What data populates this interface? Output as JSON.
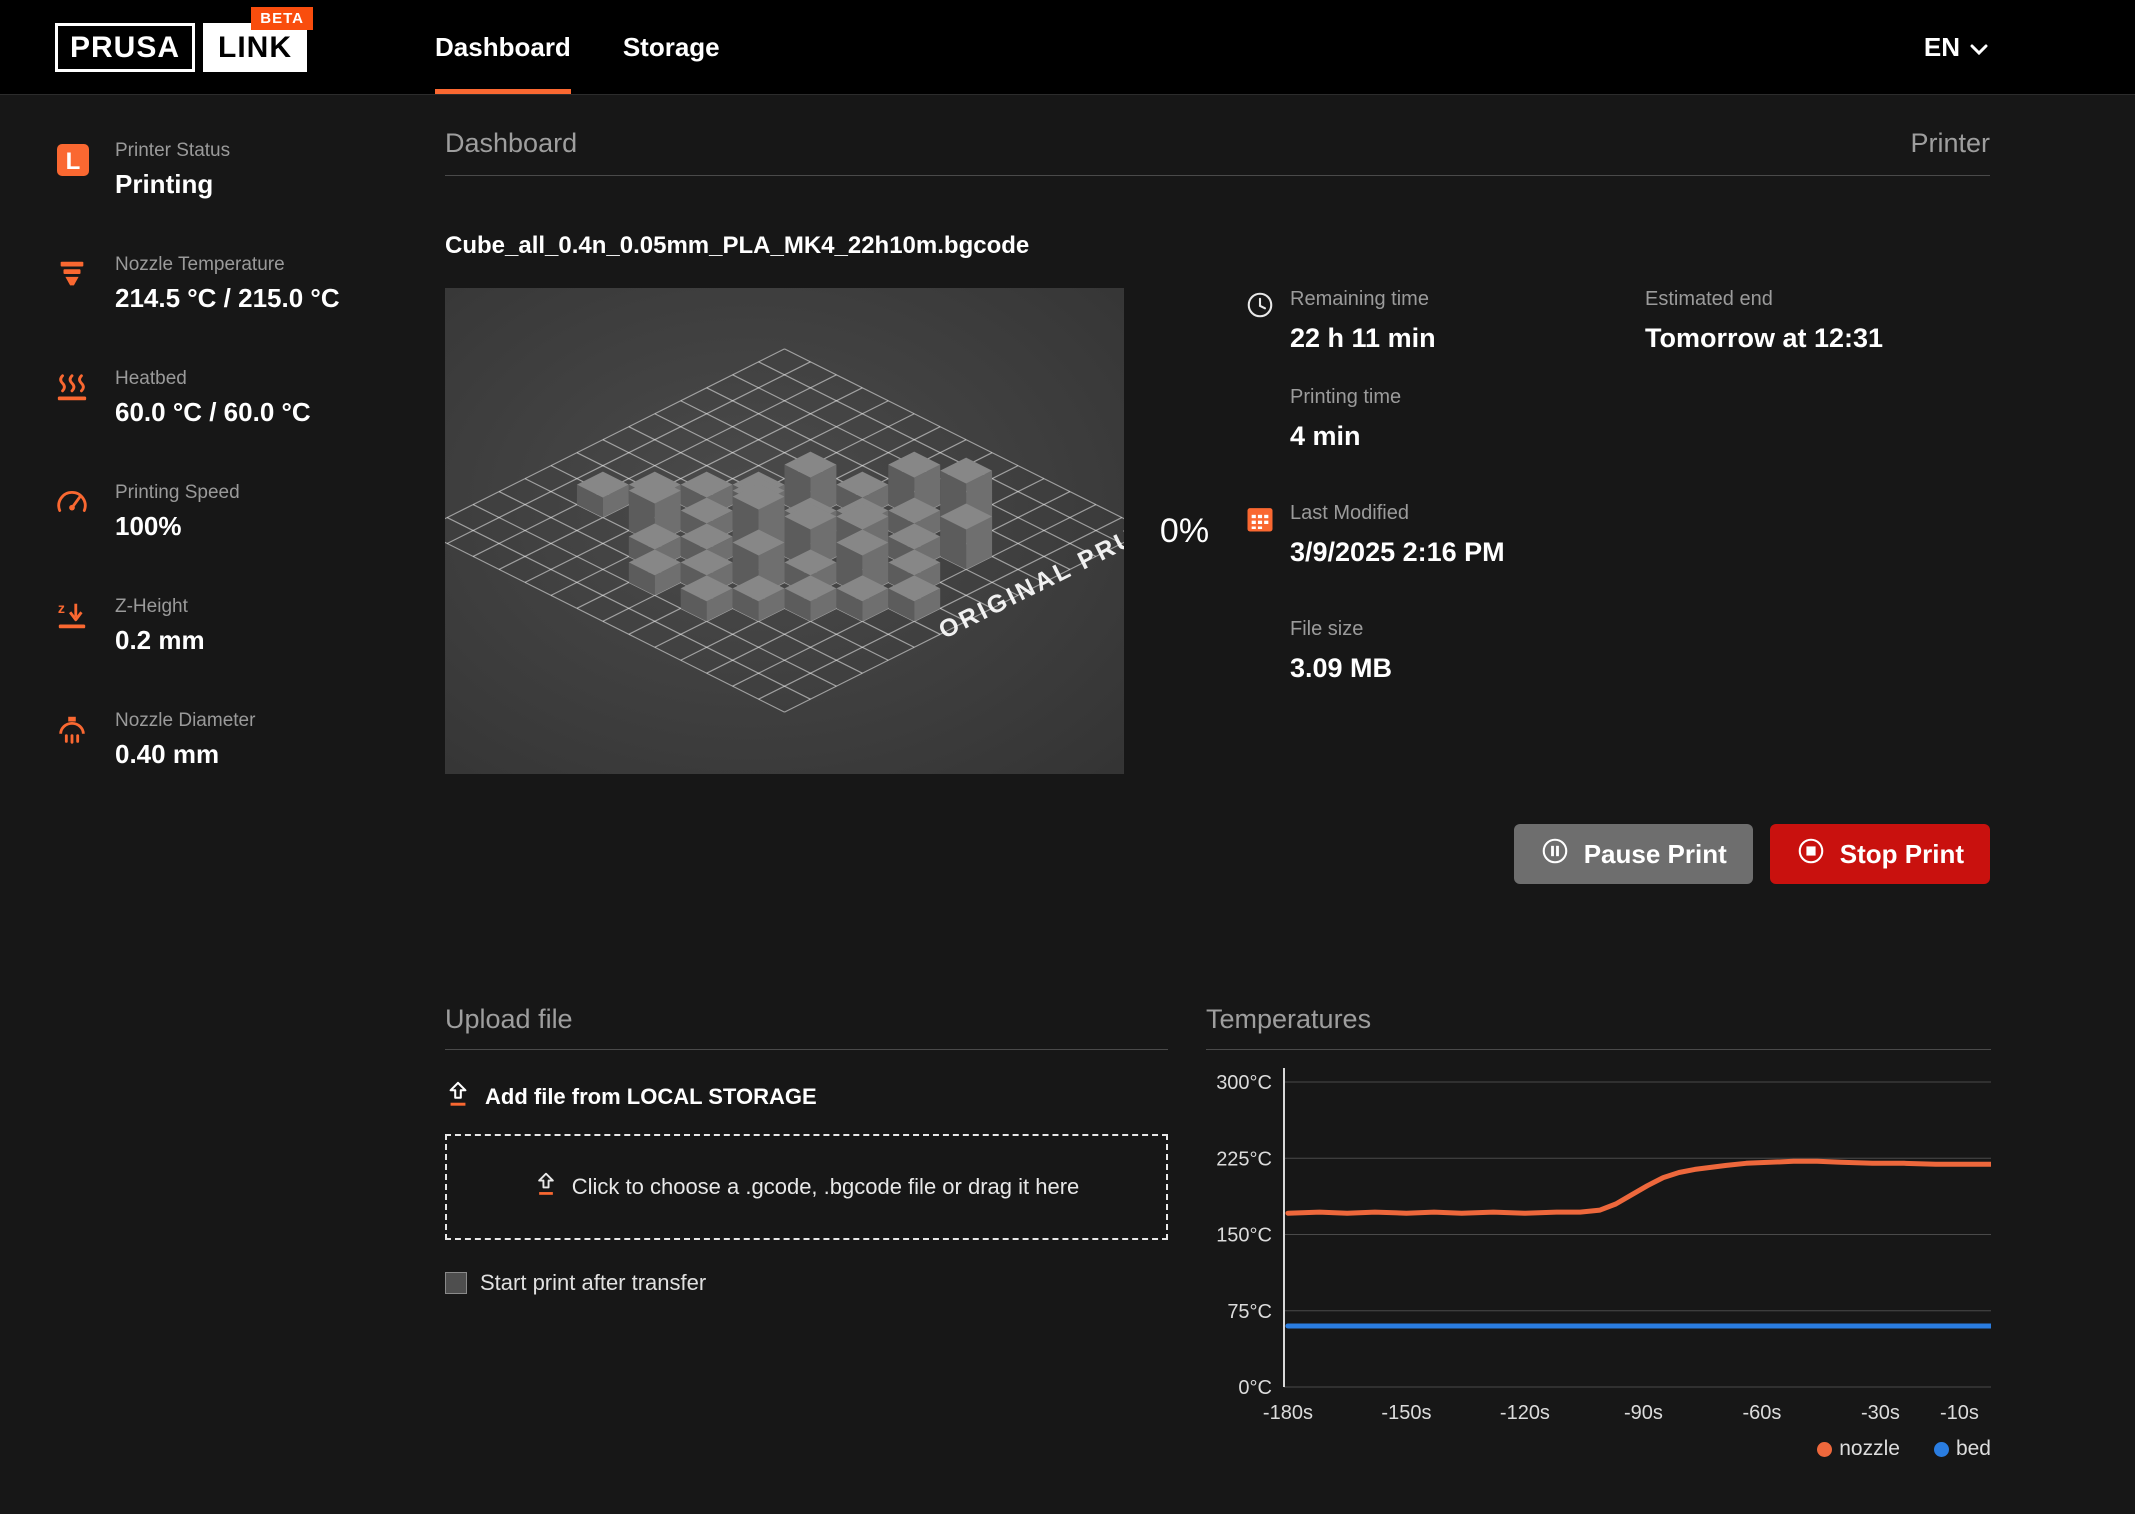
{
  "colors": {
    "accent": "#fa6831",
    "stop_red": "#c9110e",
    "pause_gray": "#6e6e6e",
    "nozzle": "#ee683c",
    "bed": "#2a7de1"
  },
  "header": {
    "logo_prusa": "PRUSA",
    "logo_link": "LINK",
    "logo_beta": "BETA",
    "tabs": [
      {
        "label": "Dashboard",
        "active": true
      },
      {
        "label": "Storage",
        "active": false
      }
    ],
    "language": "EN"
  },
  "sidebar": {
    "items": [
      {
        "label": "Printer Status",
        "value": "Printing"
      },
      {
        "label": "Nozzle Temperature",
        "value": "214.5 °C / 215.0 °C"
      },
      {
        "label": "Heatbed",
        "value": "60.0 °C / 60.0 °C"
      },
      {
        "label": "Printing Speed",
        "value": "100%"
      },
      {
        "label": "Z-Height",
        "value": "0.2 mm"
      },
      {
        "label": "Nozzle Diameter",
        "value": "0.40 mm"
      }
    ]
  },
  "main": {
    "page_title": "Dashboard",
    "page_context": "Printer",
    "filename": "Cube_all_0.4n_0.05mm_PLA_MK4_22h10m.bgcode",
    "progress": "0%",
    "preview_watermark": "ORIGINAL PRUS",
    "stats": {
      "remaining_label": "Remaining time",
      "remaining": "22 h 11 min",
      "estimated_label": "Estimated end",
      "estimated": "Tomorrow at 12:31",
      "printing_label": "Printing time",
      "printing": "4 min",
      "modified_label": "Last Modified",
      "modified": "3/9/2025 2:16 PM",
      "filesize_label": "File size",
      "filesize": "3.09 MB"
    },
    "buttons": {
      "pause": "Pause Print",
      "stop": "Stop Print"
    }
  },
  "upload": {
    "title": "Upload file",
    "add_file": "Add file from LOCAL STORAGE",
    "dropzone": "Click to choose a .gcode, .bgcode file or drag it here",
    "checkbox_label": "Start print after transfer",
    "checkbox_checked": false
  },
  "chart_data": {
    "type": "line",
    "title": "Temperatures",
    "xlabel": "",
    "ylabel": "",
    "xlim": [
      -181,
      -2
    ],
    "ylim": [
      0,
      300
    ],
    "grid": true,
    "legend_position": "bottom-right",
    "x_ticks": [
      {
        "value": -180,
        "label": "-180s"
      },
      {
        "value": -150,
        "label": "-150s"
      },
      {
        "value": -120,
        "label": "-120s"
      },
      {
        "value": -90,
        "label": "-90s"
      },
      {
        "value": -60,
        "label": "-60s"
      },
      {
        "value": -30,
        "label": "-30s"
      },
      {
        "value": -10,
        "label": "-10s"
      }
    ],
    "y_ticks": [
      {
        "value": 0,
        "label": "0°C"
      },
      {
        "value": 75,
        "label": "75°C"
      },
      {
        "value": 150,
        "label": "150°C"
      },
      {
        "value": 225,
        "label": "225°C"
      },
      {
        "value": 300,
        "label": "300°C"
      }
    ],
    "series": [
      {
        "name": "nozzle",
        "color": "#ee683c",
        "points": [
          [
            -180,
            171
          ],
          [
            -172,
            172
          ],
          [
            -165,
            171
          ],
          [
            -158,
            172
          ],
          [
            -150,
            171
          ],
          [
            -143,
            172
          ],
          [
            -136,
            171
          ],
          [
            -128,
            172
          ],
          [
            -120,
            171
          ],
          [
            -112,
            172
          ],
          [
            -106,
            172
          ],
          [
            -101,
            174
          ],
          [
            -97,
            180
          ],
          [
            -93,
            189
          ],
          [
            -89,
            198
          ],
          [
            -85,
            206
          ],
          [
            -81,
            211
          ],
          [
            -77,
            214
          ],
          [
            -73,
            216
          ],
          [
            -69,
            218
          ],
          [
            -64,
            220
          ],
          [
            -58,
            221
          ],
          [
            -52,
            222
          ],
          [
            -46,
            222
          ],
          [
            -40,
            221
          ],
          [
            -32,
            220
          ],
          [
            -24,
            220
          ],
          [
            -16,
            219
          ],
          [
            -8,
            219
          ],
          [
            -2,
            219
          ]
        ]
      },
      {
        "name": "bed",
        "color": "#2a7de1",
        "points": [
          [
            -180,
            60
          ],
          [
            -150,
            60
          ],
          [
            -120,
            60
          ],
          [
            -90,
            60
          ],
          [
            -60,
            60
          ],
          [
            -30,
            60
          ],
          [
            -2,
            60
          ]
        ]
      }
    ]
  }
}
